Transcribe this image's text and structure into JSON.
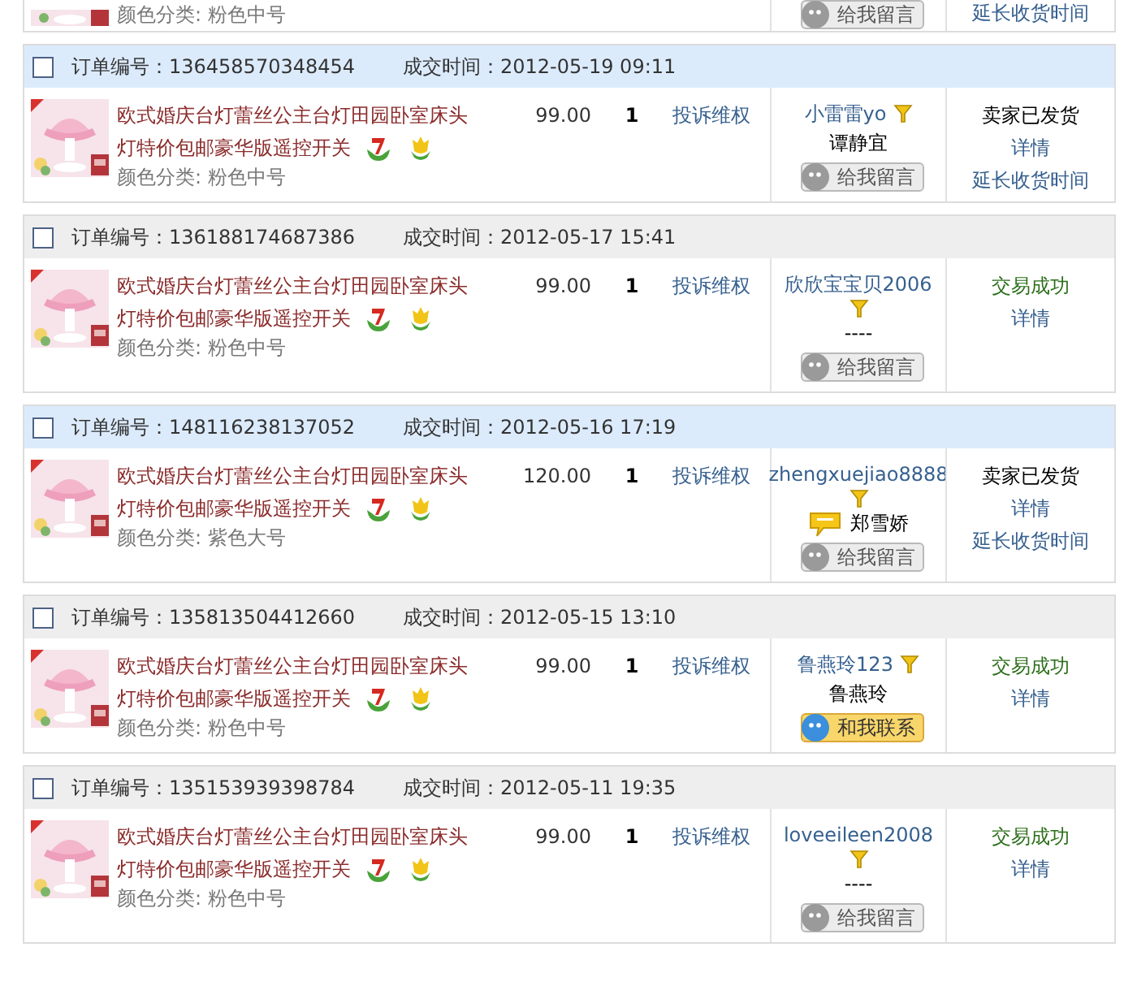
{
  "partial_order": {
    "item_variant": "颜色分类: 粉色中号",
    "message_button": "给我留言",
    "extend_link": "延长收货时间"
  },
  "orders": [
    {
      "highlighted": true,
      "selected": false,
      "order_label": "订单编号：",
      "order_no": "136458570348454",
      "time_label": "成交时间：",
      "time": "2012-05-19 09:11",
      "item": {
        "title_lines": [
          "欧式婚庆台灯蕾丝公主台灯田园卧室床头",
          "灯特价包邮豪华版遥控开关"
        ],
        "variant": "颜色分类: 粉色中号"
      },
      "price": "99.00",
      "quantity": "1",
      "complaint": "投诉维权",
      "buyer": {
        "nickname": "小雷雷yo",
        "real_name": "谭静宜",
        "chat_icon": false,
        "contact": {
          "label": "给我留言",
          "online": false
        }
      },
      "status": {
        "kind": "shipped",
        "text": "卖家已发货",
        "links": [
          "详情",
          "延长收货时间"
        ]
      }
    },
    {
      "highlighted": false,
      "selected": false,
      "order_label": "订单编号：",
      "order_no": "136188174687386",
      "time_label": "成交时间：",
      "time": "2012-05-17 15:41",
      "item": {
        "title_lines": [
          "欧式婚庆台灯蕾丝公主台灯田园卧室床头",
          "灯特价包邮豪华版遥控开关"
        ],
        "variant": "颜色分类: 粉色中号"
      },
      "price": "99.00",
      "quantity": "1",
      "complaint": "投诉维权",
      "buyer": {
        "nickname": "欣欣宝宝贝2006",
        "real_name": "----",
        "chat_icon": false,
        "contact": {
          "label": "给我留言",
          "online": false
        }
      },
      "status": {
        "kind": "success",
        "text": "交易成功",
        "links": [
          "详情"
        ]
      }
    },
    {
      "highlighted": true,
      "selected": false,
      "order_label": "订单编号：",
      "order_no": "148116238137052",
      "time_label": "成交时间：",
      "time": "2012-05-16 17:19",
      "item": {
        "title_lines": [
          "欧式婚庆台灯蕾丝公主台灯田园卧室床头",
          "灯特价包邮豪华版遥控开关"
        ],
        "variant": "颜色分类: 紫色大号"
      },
      "price": "120.00",
      "quantity": "1",
      "complaint": "投诉维权",
      "buyer": {
        "nickname": "zhengxuejiao8888",
        "real_name": "郑雪娇",
        "chat_icon": true,
        "contact": {
          "label": "给我留言",
          "online": false
        }
      },
      "status": {
        "kind": "shipped",
        "text": "卖家已发货",
        "links": [
          "详情",
          "延长收货时间"
        ]
      }
    },
    {
      "highlighted": false,
      "selected": false,
      "order_label": "订单编号：",
      "order_no": "135813504412660",
      "time_label": "成交时间：",
      "time": "2012-05-15 13:10",
      "item": {
        "title_lines": [
          "欧式婚庆台灯蕾丝公主台灯田园卧室床头",
          "灯特价包邮豪华版遥控开关"
        ],
        "variant": "颜色分类: 粉色中号"
      },
      "price": "99.00",
      "quantity": "1",
      "complaint": "投诉维权",
      "buyer": {
        "nickname": "鲁燕玲123",
        "real_name": "鲁燕玲",
        "chat_icon": false,
        "contact": {
          "label": "和我联系",
          "online": true
        }
      },
      "status": {
        "kind": "success",
        "text": "交易成功",
        "links": [
          "详情"
        ]
      }
    },
    {
      "highlighted": false,
      "selected": false,
      "order_label": "订单编号：",
      "order_no": "135153939398784",
      "time_label": "成交时间：",
      "time": "2012-05-11 19:35",
      "item": {
        "title_lines": [
          "欧式婚庆台灯蕾丝公主台灯田园卧室床头",
          "灯特价包邮豪华版遥控开关"
        ],
        "variant": "颜色分类: 粉色中号"
      },
      "price": "99.00",
      "quantity": "1",
      "complaint": "投诉维权",
      "buyer": {
        "nickname": "loveeileen2008",
        "real_name": "----",
        "chat_icon": false,
        "contact": {
          "label": "给我留言",
          "online": false
        }
      },
      "status": {
        "kind": "success",
        "text": "交易成功",
        "links": [
          "详情"
        ]
      }
    }
  ]
}
